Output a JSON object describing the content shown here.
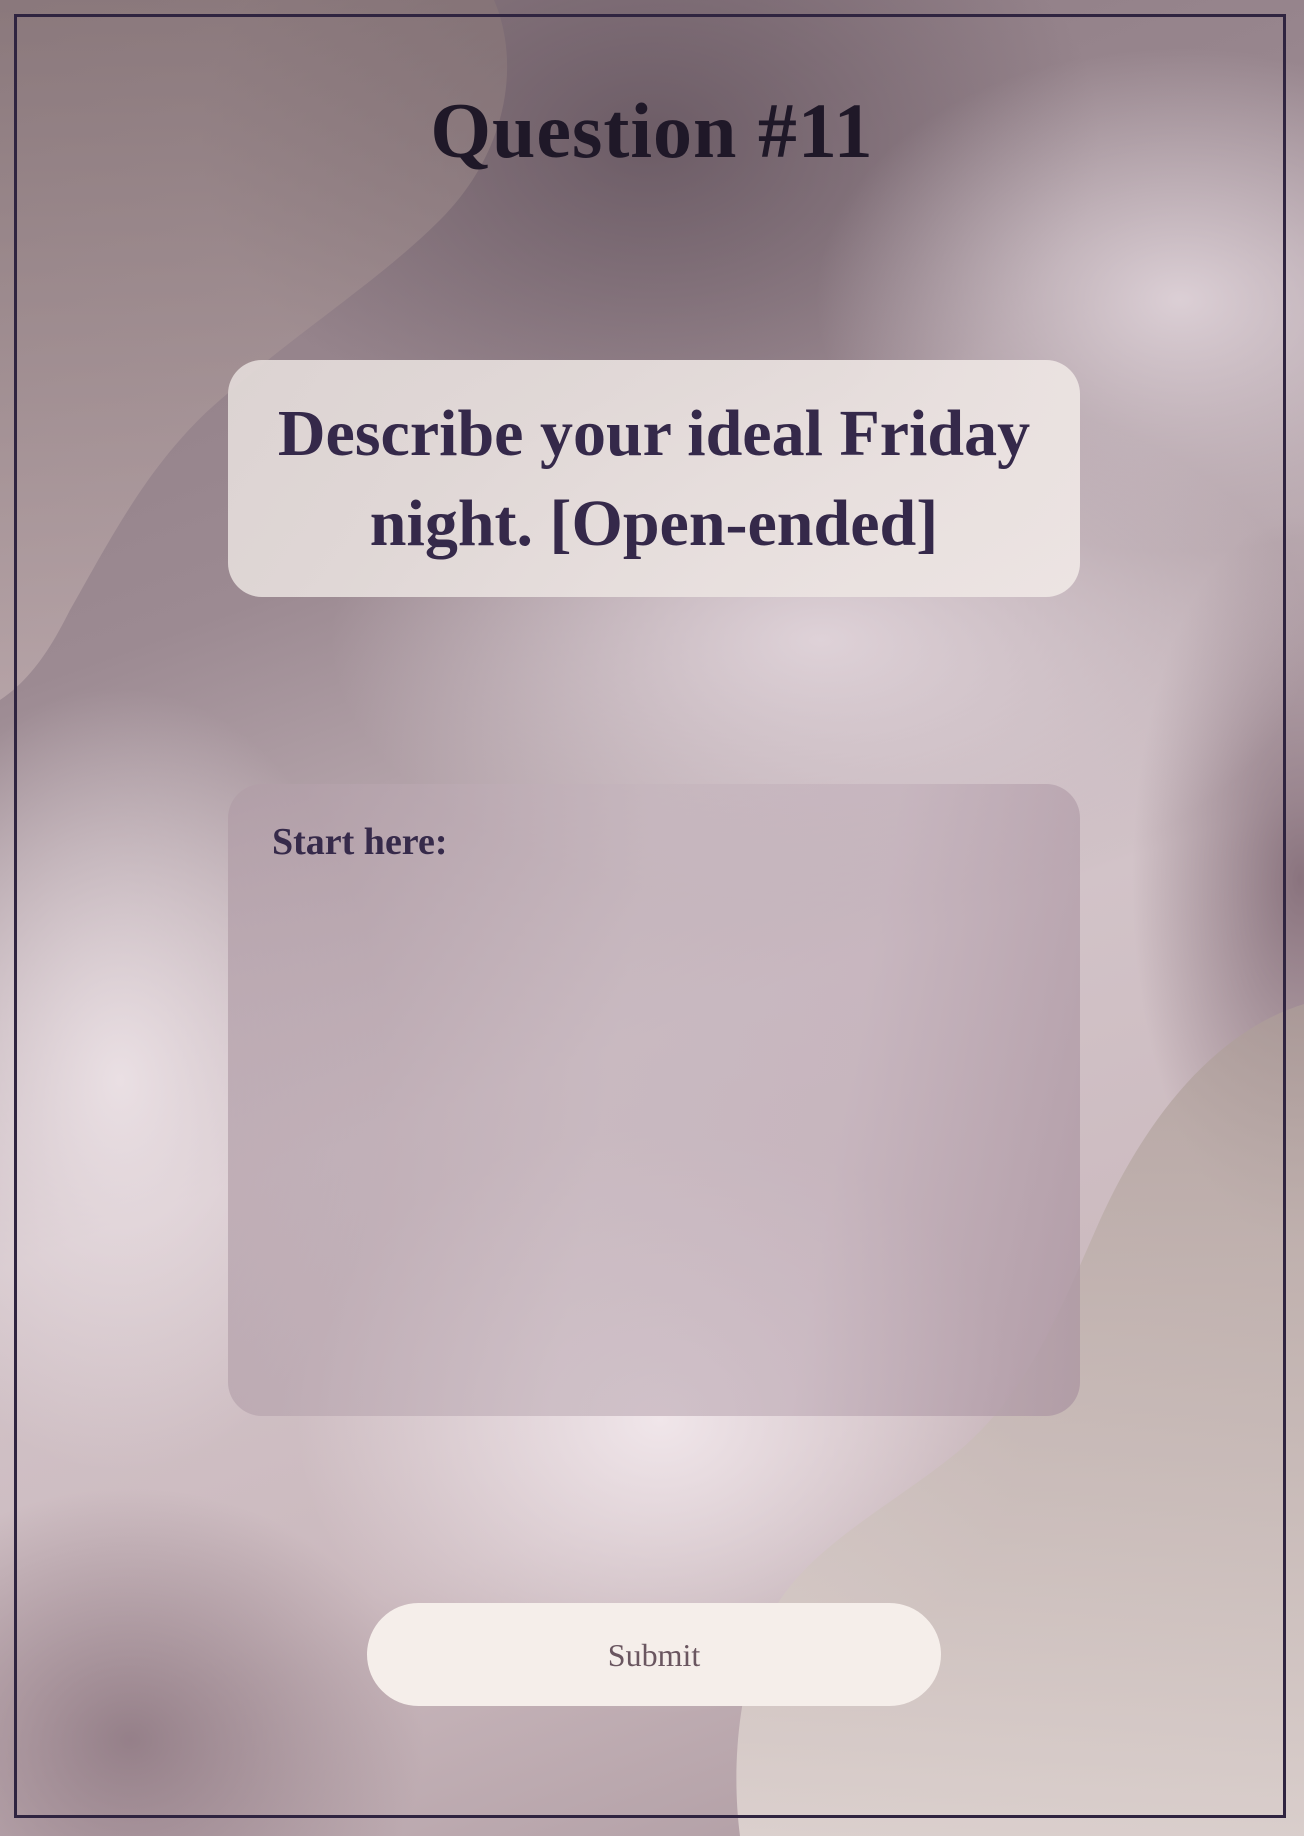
{
  "page": {
    "title": "Question #11"
  },
  "question": {
    "text": "Describe your ideal Friday night. [Open-ended]"
  },
  "answer": {
    "label": "Start here:",
    "value": ""
  },
  "submit": {
    "label": "Submit"
  },
  "colors": {
    "frame": "#2f2440",
    "title": "#1f1828",
    "question_text": "#35294a",
    "card_background": "#ebe3e0",
    "submit_background": "#f5eeea",
    "submit_text": "#6a5660"
  }
}
